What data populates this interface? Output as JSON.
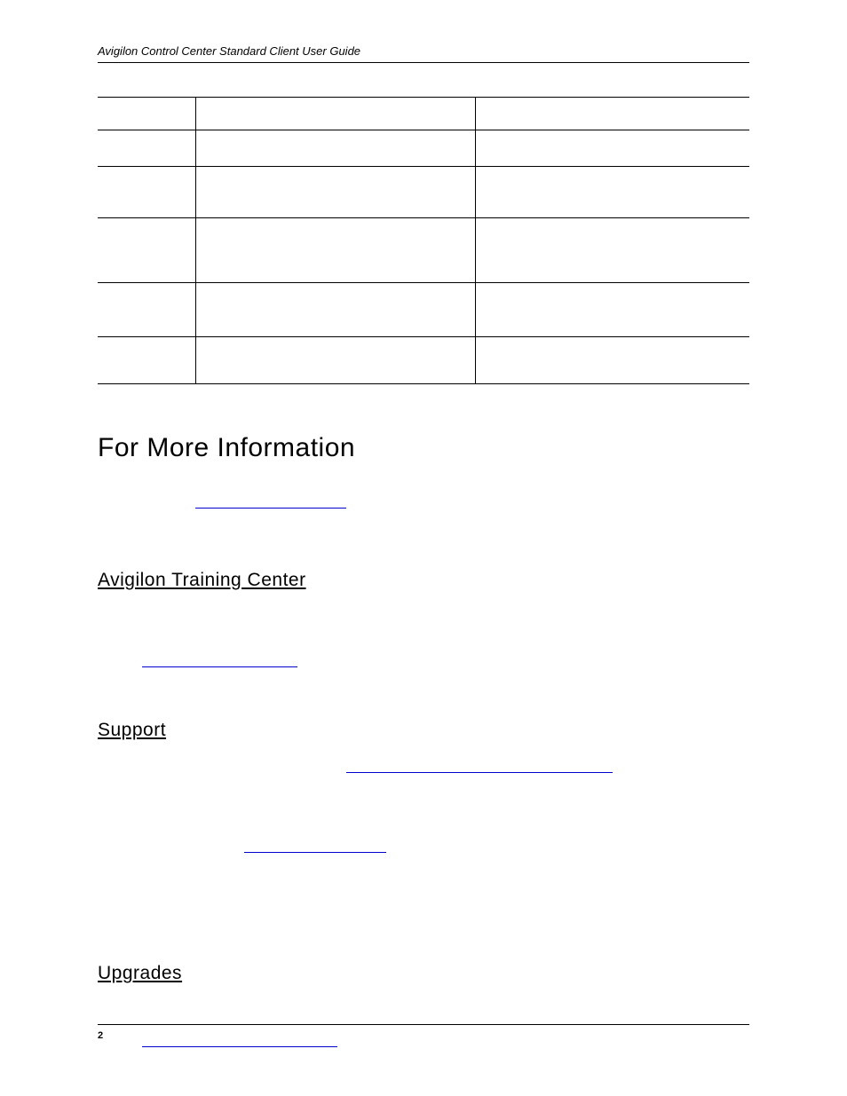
{
  "header": {
    "running_title": "Avigilon Control Center Standard Client User Guide"
  },
  "table": {
    "rows": [
      {
        "c0": "",
        "c1": "",
        "c2": ""
      },
      {
        "c0": "",
        "c1": "",
        "c2": ""
      },
      {
        "c0": "",
        "c1": "",
        "c2": ""
      },
      {
        "c0": "",
        "c1": "",
        "c2": ""
      },
      {
        "c0": "",
        "c1": "",
        "c2": ""
      },
      {
        "c0": "",
        "c1": "",
        "c2": ""
      }
    ]
  },
  "sections": {
    "for_more_information": "For More Information",
    "training_center": "Avigilon Training Center",
    "support": "Support",
    "upgrades": "Upgrades"
  },
  "footer": {
    "page_number": "2"
  }
}
